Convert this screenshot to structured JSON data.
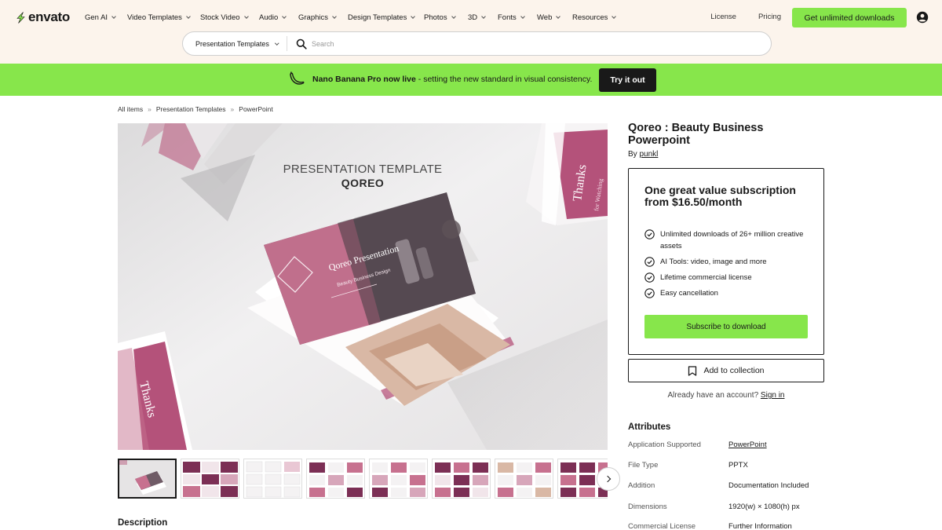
{
  "header": {
    "logo": "envato",
    "nav": [
      "Gen AI",
      "Video Templates",
      "Stock Video",
      "Audio",
      "Graphics",
      "Design Templates",
      "Photos",
      "3D",
      "Fonts",
      "Web",
      "Resources"
    ],
    "links": [
      "License",
      "Pricing"
    ],
    "cta": "Get unlimited downloads",
    "search": {
      "category": "Presentation Templates",
      "placeholder": "Search"
    }
  },
  "promo": {
    "bold": "Nano Banana Pro now live",
    "text": " - setting the new standard in visual consistency.",
    "button": "Try it out"
  },
  "breadcrumb": [
    "All items",
    "Presentation Templates",
    "PowerPoint"
  ],
  "preview": {
    "heading": "PRESENTATION TEMPLATE",
    "subheading": "QOREO",
    "card_title": "Qoreo Presentation",
    "card_subtitle": "Beauty Business Design",
    "side_card_text": "Thanks",
    "side_card_sub": "for Watching",
    "thumb_count": 8
  },
  "item": {
    "title": "Qoreo : Beauty Business Powerpoint",
    "by_label": "By",
    "author": "punkl"
  },
  "subscription": {
    "title": "One great value subscription from $16.50/month",
    "features": [
      "Unlimited downloads of 26+ million creative assets",
      "AI Tools: video, image and more",
      "Lifetime commercial license",
      "Easy cancellation"
    ],
    "button": "Subscribe to download"
  },
  "collection_button": "Add to collection",
  "account": {
    "text": "Already have an account?",
    "link": "Sign in"
  },
  "attributes": {
    "heading": "Attributes",
    "rows": [
      {
        "key": "Application Supported",
        "value": "PowerPoint"
      },
      {
        "key": "File Type",
        "value": "PPTX"
      },
      {
        "key": "Addition",
        "value": "Documentation Included"
      },
      {
        "key": "Dimensions",
        "value": "1920(w) × 1080(h) px"
      },
      {
        "key": "Commercial License",
        "value": "Further Information"
      }
    ]
  },
  "description_heading": "Description",
  "colors": {
    "accent": "#87e64b",
    "header_bg": "#fcf4ec",
    "brand_pink": "#b8587a",
    "dark": "#191919"
  }
}
